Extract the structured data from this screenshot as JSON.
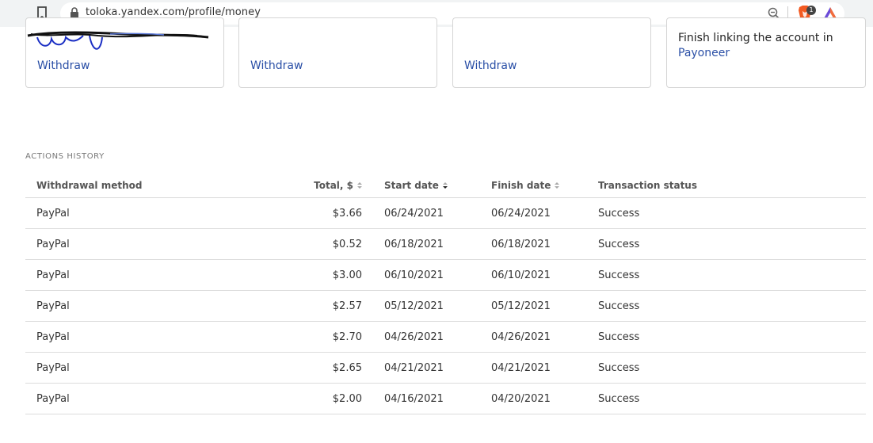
{
  "browser": {
    "url": "toloka.yandex.com/profile/money",
    "brave_badge": "1",
    "icons": [
      "bookmark-icon",
      "lock-icon",
      "zoom-icon",
      "brave-shield-icon",
      "brave-rewards-icon"
    ]
  },
  "cards": [
    {
      "link": "Withdraw"
    },
    {
      "link": "Withdraw"
    },
    {
      "link": "Withdraw"
    },
    {
      "text": "Finish linking the account in",
      "link": "Payoneer"
    }
  ],
  "actions_history": {
    "title": "Actions history",
    "columns": {
      "method": "Withdrawal method",
      "total": "Total, $",
      "start": "Start date",
      "finish": "Finish date",
      "status": "Transaction status"
    },
    "rows": [
      {
        "method": "PayPal",
        "total": "$3.66",
        "start": "06/24/2021",
        "finish": "06/24/2021",
        "status": "Success"
      },
      {
        "method": "PayPal",
        "total": "$0.52",
        "start": "06/18/2021",
        "finish": "06/18/2021",
        "status": "Success"
      },
      {
        "method": "PayPal",
        "total": "$3.00",
        "start": "06/10/2021",
        "finish": "06/10/2021",
        "status": "Success"
      },
      {
        "method": "PayPal",
        "total": "$2.57",
        "start": "05/12/2021",
        "finish": "05/12/2021",
        "status": "Success"
      },
      {
        "method": "PayPal",
        "total": "$2.70",
        "start": "04/26/2021",
        "finish": "04/26/2021",
        "status": "Success"
      },
      {
        "method": "PayPal",
        "total": "$2.65",
        "start": "04/21/2021",
        "finish": "04/21/2021",
        "status": "Success"
      },
      {
        "method": "PayPal",
        "total": "$2.00",
        "start": "04/16/2021",
        "finish": "04/20/2021",
        "status": "Success"
      }
    ]
  },
  "colors": {
    "link": "#2a4fa6",
    "border": "#d5d5d5",
    "browser_bar": "#f1f3f4"
  }
}
